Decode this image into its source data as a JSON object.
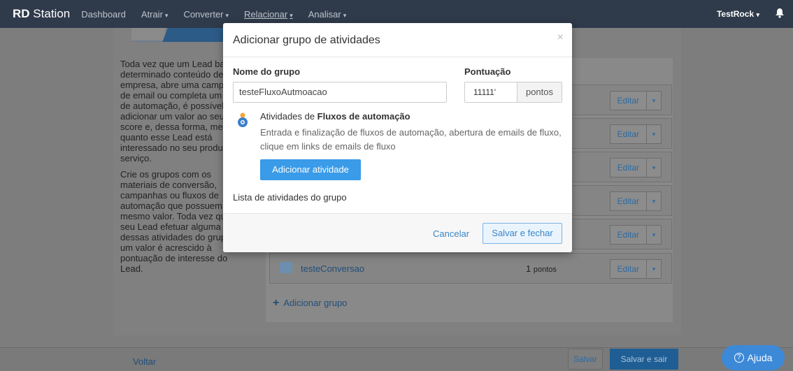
{
  "nav": {
    "brand_bold": "RD",
    "brand_light": "Station",
    "items": [
      {
        "label": "Dashboard",
        "caret": ""
      },
      {
        "label": "Atrair",
        "caret": "▾"
      },
      {
        "label": "Converter",
        "caret": "▾"
      },
      {
        "label": "Relacionar",
        "caret": "▾"
      },
      {
        "label": "Analisar",
        "caret": "▾"
      }
    ],
    "user": "TestRock",
    "user_caret": "▾",
    "bell_icon": "bell-icon"
  },
  "side": {
    "paragraph1": "Toda vez que um Lead baixa determinado conteúdo de sua empresa, abre uma campanha de email ou completa um fluxo de automação, é possível adicionar um valor ao seu score e, dessa forma, medir o quanto esse Lead está interessado no seu produto ou serviço.",
    "paragraph2": "Crie os grupos com os materiais de conversão, campanhas ou fluxos de automação que possuem o mesmo valor. Toda vez que seu Lead efetuar alguma dessas atividades do grupo, um valor é acrescido à pontuação de interesse do Lead."
  },
  "groups": {
    "edit_label": "Editar",
    "edit_caret": "▾",
    "visible_row": {
      "name": "testeConversao",
      "points_value": "1",
      "points_unit": "pontos"
    },
    "add_group_label": "Adicionar grupo"
  },
  "footer": {
    "back": "Voltar",
    "save": "Salvar",
    "save_exit": "Salvar e sair",
    "help": "Ajuda",
    "help_icon": "question-icon"
  },
  "modal": {
    "title": "Adicionar grupo de atividades",
    "close": "×",
    "group_name_label": "Nome do grupo",
    "group_name_value": "testeFluxoAutmoacao",
    "points_label": "Pontuação",
    "points_value": "11111'",
    "points_addon": "pontos",
    "activity_prefix": "Atividades de ",
    "activity_bold": "Fluxos de automação",
    "activity_desc": "Entrada e finalização de fluxos de automação, abertura de emails de fluxo, clique em links de emails de fluxo",
    "add_activity": "Adicionar atividade",
    "list_label": "Lista de atividades do grupo",
    "cancel": "Cancelar",
    "save_close": "Salvar e fechar"
  },
  "colors": {
    "navbar": "#2f3a4a",
    "primary": "#3a9be8",
    "link": "#3a86c8",
    "help": "#3c89d8"
  }
}
